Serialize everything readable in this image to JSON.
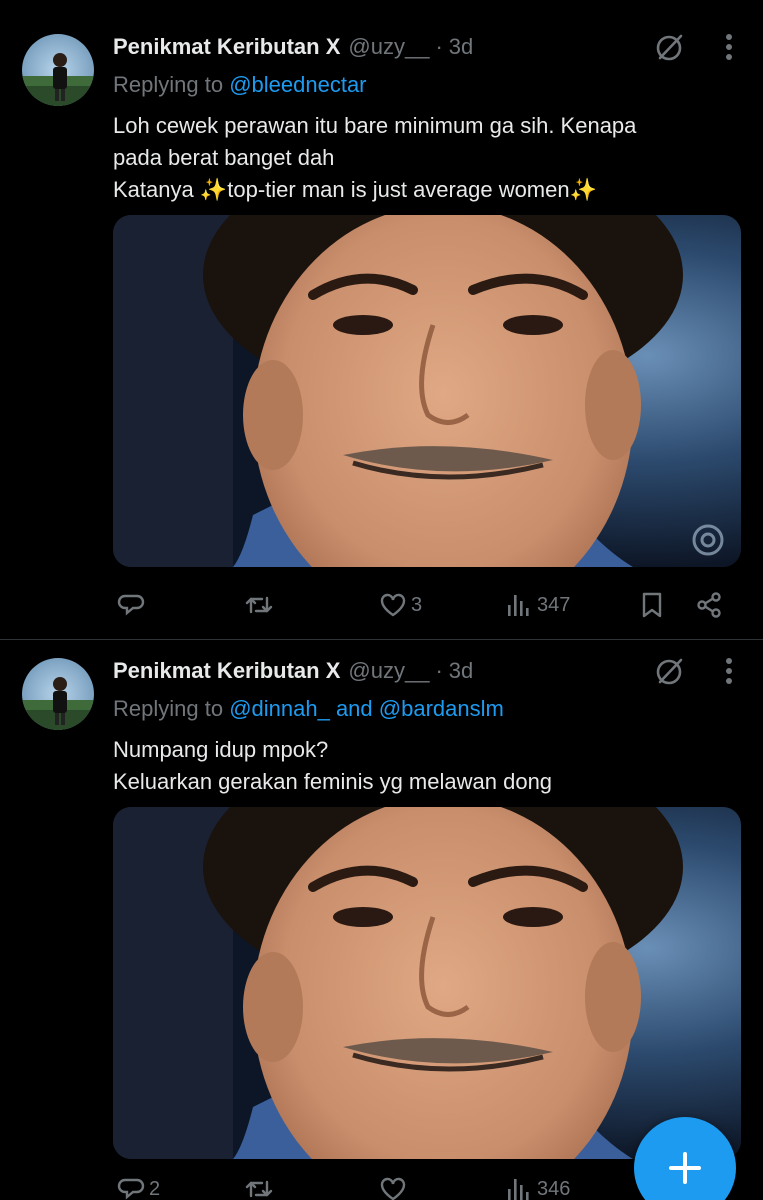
{
  "colors": {
    "background": "#000000",
    "text": "#e7e9ea",
    "muted": "#71767b",
    "accent": "#1d9bf0",
    "divider": "#2f3336"
  },
  "tweets": [
    {
      "author_name": "Penikmat Keributan X",
      "handle": "@uzy__",
      "dot": "·",
      "time": "3d",
      "replying_prefix": "Replying to",
      "replying_to": "@bleednectar",
      "text_lines": [
        "Loh cewek perawan itu bare minimum ga sih. Kenapa",
        "pada berat banget  dah",
        "Katanya ✨top-tier man is just average women✨"
      ],
      "actions": {
        "replies": "",
        "retweets": "",
        "likes": "3",
        "views": "347"
      },
      "icons": [
        "grok-icon",
        "more-icon",
        "reply-icon",
        "retweet-icon",
        "like-icon",
        "views-icon",
        "bookmark-icon",
        "share-icon"
      ]
    },
    {
      "author_name": "Penikmat Keributan X",
      "handle": "@uzy__",
      "dot": "·",
      "time": "3d",
      "replying_prefix": "Replying to",
      "replying_to": "@dinnah_ and @bardanslm",
      "text_lines": [
        "Numpang idup mpok?",
        "Keluarkan gerakan feminis yg melawan dong"
      ],
      "actions": {
        "replies": "2",
        "retweets": "",
        "likes": "",
        "views": "346"
      },
      "icons": [
        "grok-icon",
        "more-icon",
        "reply-icon",
        "retweet-icon",
        "like-icon",
        "views-icon",
        "bookmark-icon",
        "share-icon"
      ]
    }
  ],
  "fab": {
    "icon": "plus-icon"
  }
}
